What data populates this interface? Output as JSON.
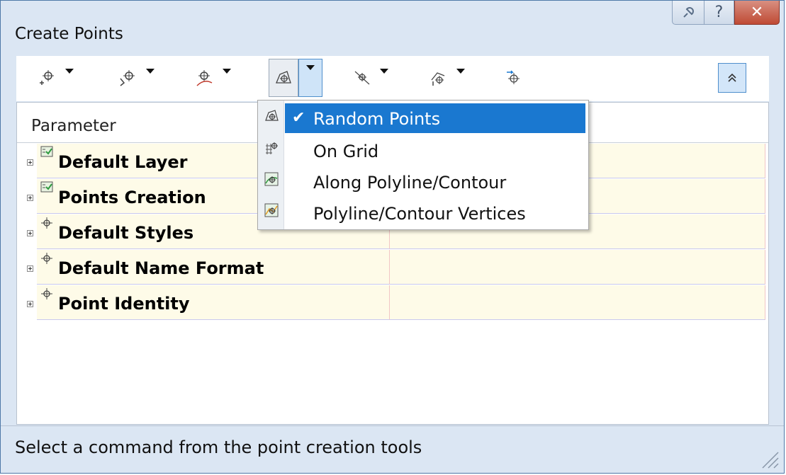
{
  "window": {
    "title": "Create Points",
    "help_glyph": "?",
    "close_glyph": "✕"
  },
  "toolbar": {
    "buttons": [
      {
        "name": "miscellaneous",
        "icon": "point-add-icon",
        "has_dropdown": true
      },
      {
        "name": "intersections",
        "icon": "point-intersection-icon",
        "has_dropdown": true
      },
      {
        "name": "alignments",
        "icon": "point-alignment-icon",
        "has_dropdown": true
      },
      {
        "name": "surfaces",
        "icon": "point-surface-icon",
        "has_dropdown": true,
        "dropdown_open": true
      },
      {
        "name": "interpolate",
        "icon": "point-interpolate-icon",
        "has_dropdown": true
      },
      {
        "name": "slope",
        "icon": "point-slope-icon",
        "has_dropdown": true
      },
      {
        "name": "convert",
        "icon": "point-convert-icon",
        "has_dropdown": false
      }
    ],
    "collapse_icon": "double-chevron-up-icon"
  },
  "table": {
    "header": "Parameter",
    "rows": [
      {
        "label": "Default Layer",
        "icon": "layer-check-icon"
      },
      {
        "label": "Points Creation",
        "icon": "layer-check-icon"
      },
      {
        "label": "Default Styles",
        "icon": "point-marker-icon"
      },
      {
        "label": "Default Name Format",
        "icon": "point-marker-icon"
      },
      {
        "label": "Point Identity",
        "icon": "point-marker-icon"
      }
    ]
  },
  "dropdown_menu": {
    "items": [
      {
        "label": "Random Points",
        "checked": true,
        "selected": true,
        "icon": "random-points-icon"
      },
      {
        "label": "On Grid",
        "checked": false,
        "selected": false,
        "icon": "grid-points-icon"
      },
      {
        "label": "Along Polyline/Contour",
        "checked": false,
        "selected": false,
        "icon": "polyline-points-icon"
      },
      {
        "label": "Polyline/Contour Vertices",
        "checked": false,
        "selected": false,
        "icon": "polyline-vertices-icon"
      }
    ],
    "check_glyph": "✔"
  },
  "status_bar": {
    "text": "Select a command from the point creation tools"
  },
  "colors": {
    "window_bg": "#dbe6f3",
    "row_bg": "#fefbe8",
    "menu_highlight": "#1a78d0",
    "close_button": "#c75a46"
  }
}
